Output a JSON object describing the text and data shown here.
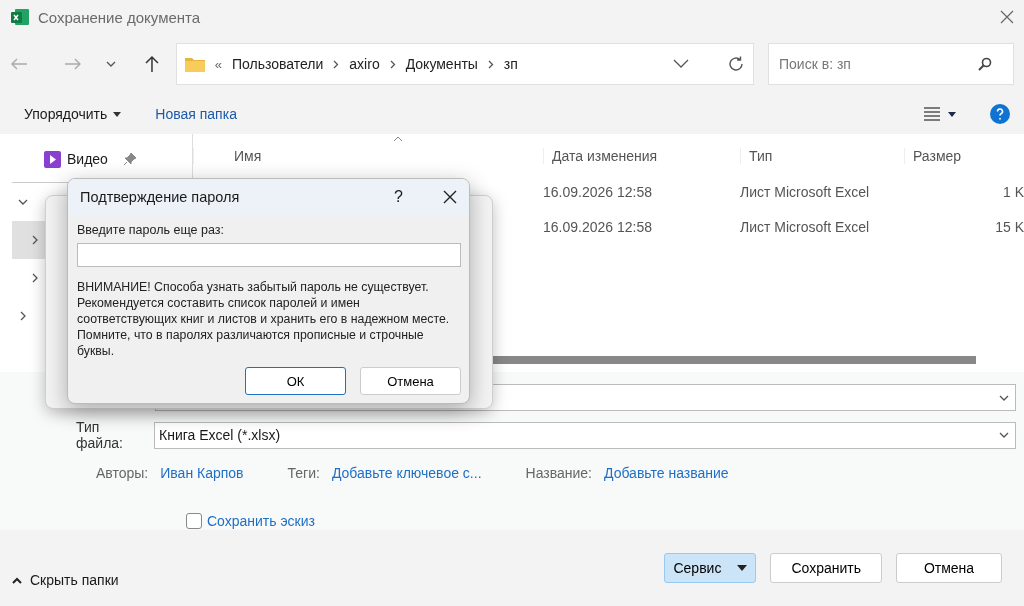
{
  "window": {
    "title": "Сохранение документа"
  },
  "address": {
    "overflow": "«",
    "crumbs": [
      "Пользователи",
      "axiro",
      "Документы",
      "зп"
    ]
  },
  "search": {
    "placeholder": "Поиск в: зп"
  },
  "commands": {
    "organize": "Упорядочить",
    "new_folder": "Новая папка"
  },
  "sidebar": {
    "items": [
      {
        "label": "Видео",
        "pinned": true
      }
    ],
    "tree": [
      {
        "expanded": true,
        "selected": false
      },
      {
        "expanded": false,
        "selected": true
      },
      {
        "expanded": false,
        "selected": false
      },
      {
        "expanded": false,
        "selected": false
      }
    ]
  },
  "table": {
    "columns": [
      "Имя",
      "Дата изменения",
      "Тип",
      "Размер"
    ],
    "rows": [
      {
        "modified": "16.09.2026 12:58",
        "type": "Лист Microsoft Excel",
        "size": "1 K"
      },
      {
        "modified": "16.09.2026 12:58",
        "type": "Лист Microsoft Excel",
        "size": "15 K"
      }
    ]
  },
  "form": {
    "file_type_label": "Тип файла:",
    "file_type": "Книга Excel (*.xlsx)",
    "meta": [
      {
        "label": "Авторы:",
        "value": "Иван Карпов"
      },
      {
        "label": "Теги:",
        "value": "Добавьте ключевое с..."
      },
      {
        "label": "Название:",
        "value": "Добавьте название"
      }
    ],
    "thumbnail": {
      "label": "Сохранить эскиз",
      "checked": false
    }
  },
  "footer": {
    "hide_folders": "Скрыть папки",
    "buttons": [
      {
        "label": "Сервис",
        "kind": "split",
        "focused": true
      },
      {
        "label": "Сохранить",
        "kind": "plain",
        "focused": false
      },
      {
        "label": "Отмена",
        "kind": "plain",
        "focused": false
      }
    ]
  },
  "password_dialog": {
    "title": "Подтверждение пароля",
    "help": "?",
    "prompt": "Введите пароль еще раз:",
    "warning": "ВНИМАНИЕ! Способа узнать забытый пароль не существует.\nРекомендуется составить список паролей и имен\nсоответствующих книг и листов и хранить его в надежном месте.\nПомните, что в паролях различаются прописные и строчные\nбуквы.",
    "buttons": [
      {
        "label": "ОК",
        "default": true
      },
      {
        "label": "Отмена",
        "default": false
      }
    ]
  }
}
